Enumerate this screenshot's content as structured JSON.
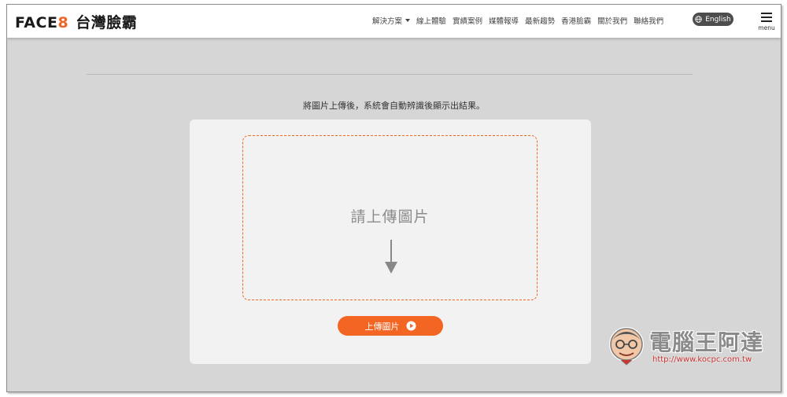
{
  "header": {
    "logo": {
      "brand": "FACE",
      "digit": "8",
      "chinese": "台灣臉霸"
    },
    "nav": [
      {
        "label": "解決方案",
        "has_dropdown": true
      },
      {
        "label": "線上體驗"
      },
      {
        "label": "實績案例"
      },
      {
        "label": "媒體報導"
      },
      {
        "label": "最新趨勢"
      },
      {
        "label": "香港臉霸"
      },
      {
        "label": "關於我們"
      },
      {
        "label": "聯絡我們"
      }
    ],
    "language_button": {
      "label": "English",
      "icon": "globe-icon"
    },
    "menu": {
      "label": "menu",
      "icon": "hamburger-icon"
    }
  },
  "main": {
    "instructions": "將圖片上傳後，系統會自動辨識後顯示出結果。",
    "drop_zone": {
      "title": "請上傳圖片",
      "icon": "arrow-down-icon"
    },
    "upload_button": {
      "label": "上傳圖片",
      "icon": "play-circle-icon"
    }
  },
  "watermark": {
    "title": "電腦王阿達",
    "url": "http://www.kocpc.com.tw"
  },
  "colors": {
    "accent": "#f26522",
    "background": "#d6d6d6",
    "card": "#f2f2f2",
    "header": "#ffffff",
    "lang_button": "#4d4d4d"
  }
}
